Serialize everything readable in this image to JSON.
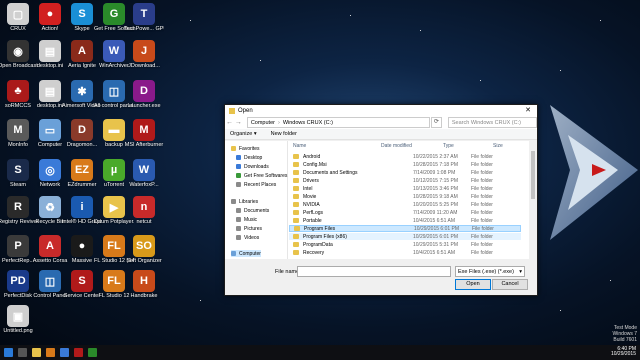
{
  "desktop_icons": [
    {
      "label": "CRUX",
      "color": "#d0d0d0",
      "glyph": "▢"
    },
    {
      "label": "Action!",
      "color": "#d12020",
      "glyph": "●"
    },
    {
      "label": "Skype",
      "color": "#1a8fd6",
      "glyph": "S"
    },
    {
      "label": "Get Free Softwares",
      "color": "#2a8a2a",
      "glyph": "G"
    },
    {
      "label": "TechPowe... GPU-Z",
      "color": "#2a3d8a",
      "glyph": "T"
    },
    {
      "label": "Open Broadcast...",
      "color": "#333",
      "glyph": "◉"
    },
    {
      "label": "desktop.ini",
      "color": "#cfcfcf",
      "glyph": "▤"
    },
    {
      "label": "Aeria Ignite",
      "color": "#8a2a1a",
      "glyph": "A"
    },
    {
      "label": "WinArchiver",
      "color": "#3a5ab8",
      "glyph": "W"
    },
    {
      "label": "JDownload...",
      "color": "#c84a1a",
      "glyph": "J"
    },
    {
      "label": "soRMCCS",
      "color": "#aa1a1a",
      "glyph": "♣"
    },
    {
      "label": "desktop.ini",
      "color": "#cfcfcf",
      "glyph": "▤"
    },
    {
      "label": "Aimersoft Video C...",
      "color": "#2a6ab0",
      "glyph": "✱"
    },
    {
      "label": "All control panel items",
      "color": "#2a6ab0",
      "glyph": "◫"
    },
    {
      "label": "Launcher.exe",
      "color": "#8a1a8a",
      "glyph": "D"
    },
    {
      "label": "MonInfo",
      "color": "#5a5a5a",
      "glyph": "M"
    },
    {
      "label": "Computer",
      "color": "#6aa0d8",
      "glyph": "▭"
    },
    {
      "label": "Dragomon...",
      "color": "#8a3a2a",
      "glyph": "D"
    },
    {
      "label": "backup",
      "color": "#e8c34b",
      "glyph": "▬"
    },
    {
      "label": "MSI Afterburner",
      "color": "#b01a1a",
      "glyph": "M"
    },
    {
      "label": "Steam",
      "color": "#1a2a4a",
      "glyph": "S"
    },
    {
      "label": "Network",
      "color": "#3a7ad8",
      "glyph": "◎"
    },
    {
      "label": "EZdrummer",
      "color": "#d87a1a",
      "glyph": "EZ"
    },
    {
      "label": "uTorrent",
      "color": "#4aaa2a",
      "glyph": "µ"
    },
    {
      "label": "WaterfoxP...",
      "color": "#2a5ab0",
      "glyph": "W"
    },
    {
      "label": "Registry Reviver",
      "color": "#2a2a2a",
      "glyph": "R"
    },
    {
      "label": "Recycle Bin",
      "color": "#8ab0d8",
      "glyph": "♻"
    },
    {
      "label": "Intel® HD Graphics C...",
      "color": "#1a5ab0",
      "glyph": "i"
    },
    {
      "label": "Daum Potplayer...",
      "color": "#e8c34b",
      "glyph": "▶"
    },
    {
      "label": "netcut",
      "color": "#c82a2a",
      "glyph": "n"
    },
    {
      "label": "PerfectRep...",
      "color": "#3a3a3a",
      "glyph": "P"
    },
    {
      "label": "Assetto Corsa",
      "color": "#c82a2a",
      "glyph": "A"
    },
    {
      "label": "Massive",
      "color": "#1a1a1a",
      "glyph": "●"
    },
    {
      "label": "FL Studio 12 (64bit)",
      "color": "#d87a1a",
      "glyph": "FL"
    },
    {
      "label": "Soft Organizer",
      "color": "#d89a1a",
      "glyph": "SO"
    },
    {
      "label": "PerfectDisk",
      "color": "#1a3a8a",
      "glyph": "PD"
    },
    {
      "label": "Control Panel",
      "color": "#2a6ab0",
      "glyph": "◫"
    },
    {
      "label": "Service Center",
      "color": "#b01a1a",
      "glyph": "S"
    },
    {
      "label": "FL Studio 12",
      "color": "#d87a1a",
      "glyph": "FL"
    },
    {
      "label": "Handbrake",
      "color": "#c84a1a",
      "glyph": "H"
    },
    {
      "label": "Untitled.png",
      "color": "#cfcfcf",
      "glyph": "▣"
    }
  ],
  "dialog": {
    "title": "Open",
    "address_parts": [
      "Computer",
      "Windows CRUX (C:)"
    ],
    "search_placeholder": "Search Windows CRUX (C:)",
    "organize": "Organize ▾",
    "new_folder": "New folder",
    "nav": [
      {
        "label": "Favorites",
        "color": "#e8c34b"
      },
      {
        "label": "Desktop",
        "color": "#3a7ad8"
      },
      {
        "label": "Downloads",
        "color": "#3a7ad8"
      },
      {
        "label": "Get Free Softwares",
        "color": "#3a9a3a"
      },
      {
        "label": "Recent Places",
        "color": "#8a8a8a"
      },
      {
        "label": "Libraries",
        "color": "#8a8a8a"
      },
      {
        "label": "Documents",
        "color": "#8a8a8a"
      },
      {
        "label": "Music",
        "color": "#8a8a8a"
      },
      {
        "label": "Pictures",
        "color": "#8a8a8a"
      },
      {
        "label": "Videos",
        "color": "#8a8a8a"
      },
      {
        "label": "Computer",
        "color": "#6aa0d8"
      }
    ],
    "columns": {
      "name": "Name",
      "date": "Date modified",
      "type": "Type",
      "size": "Size"
    },
    "files": [
      {
        "name": "Android",
        "date": "10/22/2015 2:37 AM",
        "type": "File folder"
      },
      {
        "name": "Config.Msi",
        "date": "10/28/2015 7:18 PM",
        "type": "File folder"
      },
      {
        "name": "Documents and Settings",
        "date": "7/14/2009 1:08 PM",
        "type": "File folder"
      },
      {
        "name": "Drivers",
        "date": "10/12/2015 7:15 PM",
        "type": "File folder"
      },
      {
        "name": "Intel",
        "date": "10/13/2015 3:46 PM",
        "type": "File folder"
      },
      {
        "name": "Movie",
        "date": "10/28/2015 9:18 AM",
        "type": "File folder"
      },
      {
        "name": "NVIDIA",
        "date": "10/20/2015 5:25 PM",
        "type": "File folder"
      },
      {
        "name": "PerfLogs",
        "date": "7/14/2009 11:20 AM",
        "type": "File folder"
      },
      {
        "name": "Portable",
        "date": "10/4/2015 6:51 AM",
        "type": "File folder"
      },
      {
        "name": "Program Files",
        "date": "10/29/2015 6:01 PM",
        "type": "File folder"
      },
      {
        "name": "Program Files (x86)",
        "date": "10/29/2015 6:01 PM",
        "type": "File folder"
      },
      {
        "name": "ProgramData",
        "date": "10/29/2015 5:31 PM",
        "type": "File folder"
      },
      {
        "name": "Recovery",
        "date": "10/4/2015 6:51 AM",
        "type": "File folder"
      }
    ],
    "selected_index": 9,
    "hover_index": 10,
    "filename_label": "File name:",
    "filename_value": "",
    "filter": "Exe Files (.exe) (*.exe)",
    "open_button": "Open",
    "cancel_button": "Cancel"
  },
  "bottom_right": [
    "Test Mode",
    "Windows 7",
    "Build 7601"
  ],
  "tray": {
    "time": "6:40 PM",
    "date": "10/29/2015"
  }
}
